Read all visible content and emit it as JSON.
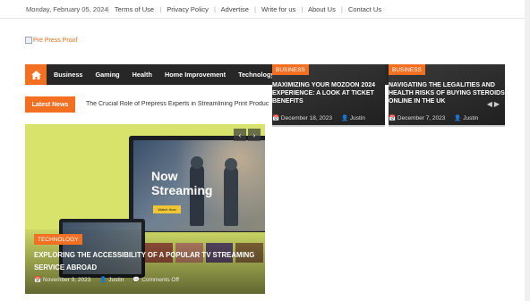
{
  "topbar": {
    "date": "Monday, February 05, 2024",
    "links": [
      "Terms of Use",
      "Privacy Policy",
      "Advertise",
      "Write for us",
      "About Us",
      "Contact Us"
    ]
  },
  "logo": {
    "alt_text": "Pre Press Proof",
    "icon": "broken-image-icon"
  },
  "nav": {
    "home_icon": "home-icon",
    "items": [
      "Business",
      "Gaming",
      "Health",
      "Home Improvement",
      "Technology"
    ],
    "search_icon": "search-icon"
  },
  "latest_news": {
    "label": "Latest News",
    "headline": "The Crucial Role of Prepress Experts in Streamlining Print Production"
  },
  "hero": {
    "screen_text": "Now Streaming",
    "screen_button": "Watch Now",
    "category": "TECHNOLOGY",
    "title": "EXPLORING THE ACCESSIBILITY OF A POPULAR TV STREAMING SERVICE ABROAD",
    "date": "November 9, 2023",
    "author": "Justin",
    "comments": "Comments Off",
    "prev": "‹",
    "next": "›"
  },
  "card1": {
    "category": "BUSINESS",
    "title": "MAXIMIZING YOUR MOZOON 2024 EXPERIENCE: A LOOK AT TICKET BENEFITS",
    "date": "December 18, 2023",
    "author": "Justin"
  },
  "card2": {
    "category": "BUSINESS",
    "title": "NAVIGATING THE LEGALITIES AND HEALTH RISKS OF BUYING STEROIDS ONLINE IN THE UK",
    "date": "December 7, 2023",
    "author": "Justin"
  },
  "colors": {
    "accent": "#f36f21",
    "nav_bg": "#272727",
    "hero_bg": "#d7e36a"
  }
}
